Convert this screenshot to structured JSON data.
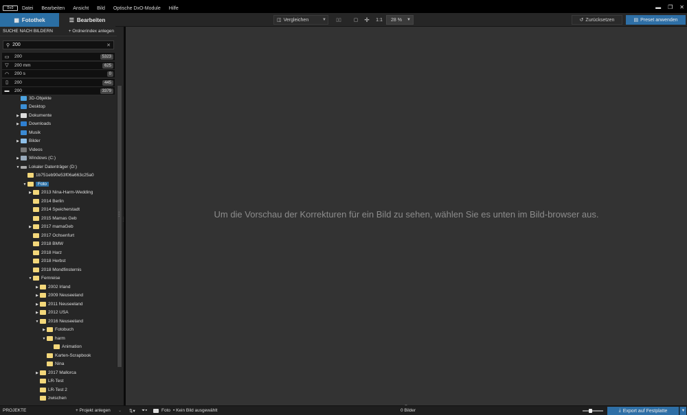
{
  "app": {
    "logo_text": "DxO"
  },
  "menu": [
    "Datei",
    "Bearbeiten",
    "Ansicht",
    "Bild",
    "Optische DxO-Module",
    "Hilfe"
  ],
  "window_controls": {
    "minimize": "▬",
    "restore": "❐",
    "close": "✕"
  },
  "tabs": {
    "library": "Fotothek",
    "edit": "Bearbeiten"
  },
  "toolbar": {
    "compare": "Vergleichen",
    "one_to_one": "1:1",
    "zoom": "28 %",
    "reset": "Zurücksetzen",
    "apply_preset": "Preset anwenden"
  },
  "sidebar": {
    "header_title": "SUCHE NACH BILDERN",
    "add_index": "+ Ordnerindex anlegen",
    "search_value": "200",
    "suggestions": [
      {
        "icon": "iso-icon",
        "text": "200",
        "count": "5323"
      },
      {
        "icon": "focal-length-icon",
        "text": "200 mm",
        "count": "625"
      },
      {
        "icon": "shutter-speed-icon",
        "text": "200 s",
        "count": "0"
      },
      {
        "icon": "file-icon",
        "text": "200",
        "count": "445"
      },
      {
        "icon": "folder-icon",
        "text": "200",
        "count": "3379"
      }
    ],
    "tree": [
      {
        "label": "3D-Objekte",
        "icon": "3d-objects-icon"
      },
      {
        "label": "Desktop",
        "icon": "desktop-icon"
      },
      {
        "label": "Dokumente",
        "icon": "documents-icon"
      },
      {
        "label": "Downloads",
        "icon": "downloads-icon"
      },
      {
        "label": "Musik",
        "icon": "music-icon"
      },
      {
        "label": "Bilder",
        "icon": "pictures-icon"
      },
      {
        "label": "Videos",
        "icon": "videos-icon"
      },
      {
        "label": "Windows (C:)",
        "icon": "drive-icon"
      },
      {
        "label": "Lokaler Datenträger (D:)",
        "icon": "drive-icon"
      },
      {
        "label": "1b751eb90e53f06a663c25a0",
        "icon": "folder-icon"
      },
      {
        "label": "Foto",
        "icon": "folder-icon"
      },
      {
        "label": "2013 Nina-Harm-Wedding",
        "icon": "folder-icon"
      },
      {
        "label": "2014 Berlin",
        "icon": "folder-icon"
      },
      {
        "label": "2014 Speicherstadt",
        "icon": "folder-icon"
      },
      {
        "label": "2015 Mamas Geb",
        "icon": "folder-icon"
      },
      {
        "label": "2017 mamaGeb",
        "icon": "folder-icon"
      },
      {
        "label": "2017 Ochsenfurt",
        "icon": "folder-icon"
      },
      {
        "label": "2018 BMW",
        "icon": "folder-icon"
      },
      {
        "label": "2018 Harz",
        "icon": "folder-icon"
      },
      {
        "label": "2018 Herbst",
        "icon": "folder-icon"
      },
      {
        "label": "2018 Mondfinsternis",
        "icon": "folder-icon"
      },
      {
        "label": "Fernreise",
        "icon": "folder-icon"
      },
      {
        "label": "2002 Irland",
        "icon": "folder-icon"
      },
      {
        "label": "2009 Neuseeland",
        "icon": "folder-icon"
      },
      {
        "label": "2011 Neuseeland",
        "icon": "folder-icon"
      },
      {
        "label": "2012 USA",
        "icon": "folder-icon"
      },
      {
        "label": "2016 Neuseeland",
        "icon": "folder-icon"
      },
      {
        "label": "Fotobuch",
        "icon": "folder-icon"
      },
      {
        "label": "harm",
        "icon": "folder-icon"
      },
      {
        "label": "Animation",
        "icon": "folder-icon"
      },
      {
        "label": "Karten-Scrapbook",
        "icon": "folder-icon"
      },
      {
        "label": "Nina",
        "icon": "folder-icon"
      },
      {
        "label": "2017 Mallorca",
        "icon": "folder-icon"
      },
      {
        "label": "LR-Test",
        "icon": "folder-icon"
      },
      {
        "label": "LR-Test 2",
        "icon": "folder-icon"
      },
      {
        "label": "zwischen",
        "icon": "folder-icon"
      }
    ]
  },
  "main": {
    "empty_message": "Um die Vorschau der Korrekturen für ein Bild zu sehen, wählen Sie es unten im Bild-browser aus."
  },
  "bottombar": {
    "projects": "PROJEKTE",
    "add_project": "+ Projekt anlegen",
    "folder": "Foto",
    "selection": "• Kein Bild ausgewählt",
    "image_count": "0 Bilder",
    "export": "Export auf Festplatte"
  },
  "colors": {
    "accent": "#2b6fa4",
    "folder": "#f3d77a",
    "panel": "#262626",
    "viewer": "#333333"
  }
}
